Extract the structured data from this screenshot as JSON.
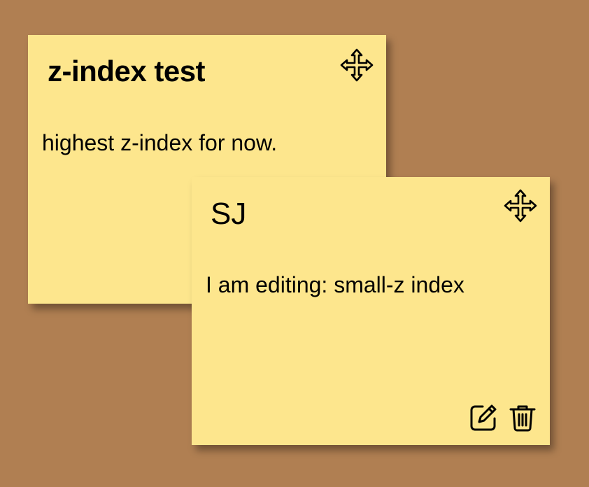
{
  "colors": {
    "board_background": "#b07f52",
    "note_background": "#fde68d",
    "ink": "#000000"
  },
  "notes": [
    {
      "title": "z-index test",
      "body": "highest z-index for now.",
      "icons": [
        "move-icon"
      ]
    },
    {
      "title": "SJ",
      "body": "I am editing: small-z index",
      "icons": [
        "move-icon",
        "edit-icon",
        "trash-icon"
      ]
    }
  ]
}
